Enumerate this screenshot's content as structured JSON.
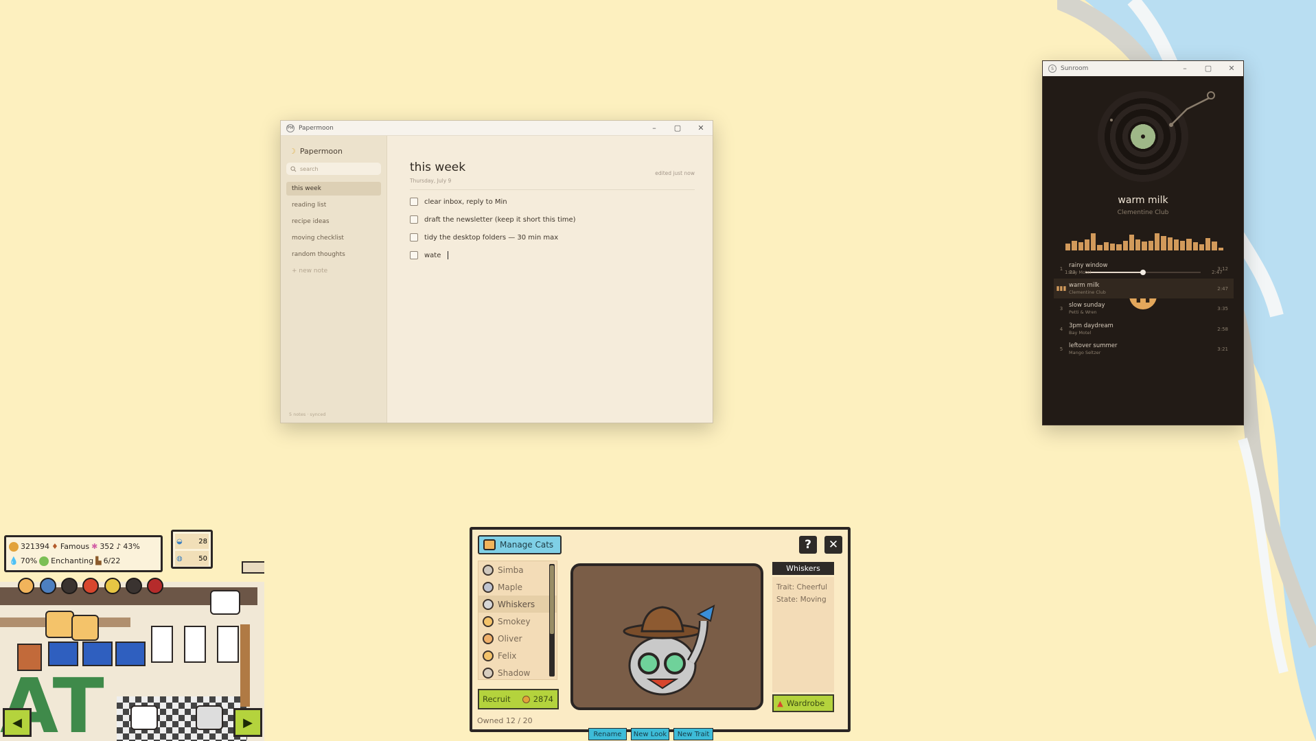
{
  "papermoon": {
    "window_title": "Papermoon",
    "app_name": "Papermoon",
    "search_placeholder": "search",
    "notes": [
      "this week",
      "reading list",
      "recipe ideas",
      "moving checklist",
      "random thoughts"
    ],
    "new_note": "+ new note",
    "footer": "5 notes · synced",
    "note": {
      "title": "this week",
      "date": "Thursday, July 9",
      "edited": "edited just now",
      "todos": [
        "clear inbox, reply to Min",
        "draft the newsletter (keep it short this time)",
        "tidy the desktop folders — 30 min max",
        "wate"
      ]
    }
  },
  "sunroom": {
    "window_title": "Sunroom",
    "now_playing": {
      "title": "warm milk",
      "artist": "Clementine Club",
      "elapsed": "1:23",
      "duration": "2:47",
      "progress": 0.5
    },
    "playlist": [
      {
        "num": "1",
        "title": "rainy window",
        "artist": "Bay Motel",
        "duration": "3:12"
      },
      {
        "num": "",
        "title": "warm milk",
        "artist": "Clementine Club",
        "duration": "2:47"
      },
      {
        "num": "3",
        "title": "slow sunday",
        "artist": "Petti & Wren",
        "duration": "3:35"
      },
      {
        "num": "4",
        "title": "3pm daydream",
        "artist": "Bay Motel",
        "duration": "2:58"
      },
      {
        "num": "5",
        "title": "leftover summer",
        "artist": "Mango Seltzer",
        "duration": "3:21"
      }
    ],
    "accent": "#e3a75b"
  },
  "game": {
    "stats": {
      "coins": "321394",
      "fame": "Famous",
      "gems": "352",
      "music": "43%",
      "water": "70%",
      "mood": "Enchanting",
      "chairs": "6/22"
    },
    "resources": {
      "fish": "28",
      "milk": "50"
    },
    "manage_cats": {
      "title": "Manage Cats",
      "cats": [
        "Simba",
        "Maple",
        "Whiskers",
        "Smokey",
        "Oliver",
        "Felix",
        "Shadow"
      ],
      "selected": "Whiskers",
      "trait": "Trait: Cheerful",
      "state": "State: Moving",
      "rename": "Rename",
      "new_look": "New Look",
      "new_trait": "New Trait",
      "recruit": "Recruit",
      "recruit_cost": "2874",
      "wardrobe": "Wardrobe",
      "owned": "Owned 12 / 20",
      "help": "?",
      "close": "✕"
    }
  }
}
